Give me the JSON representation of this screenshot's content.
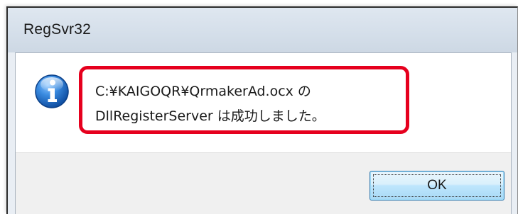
{
  "dialog": {
    "title": "RegSvr32",
    "icon": "information-icon",
    "message_line1": "C:¥KAIGOQR¥QrmakerAd.ocx の",
    "message_line2": "DllRegisterServer は成功しました。",
    "ok_label": "OK"
  },
  "colors": {
    "highlight_border": "#e6001e",
    "title_bar": "#d5dfea",
    "button_area": "#f0f0f0",
    "ok_button_border": "#3c7fb1",
    "info_icon_blue": "#1f6fc5"
  }
}
